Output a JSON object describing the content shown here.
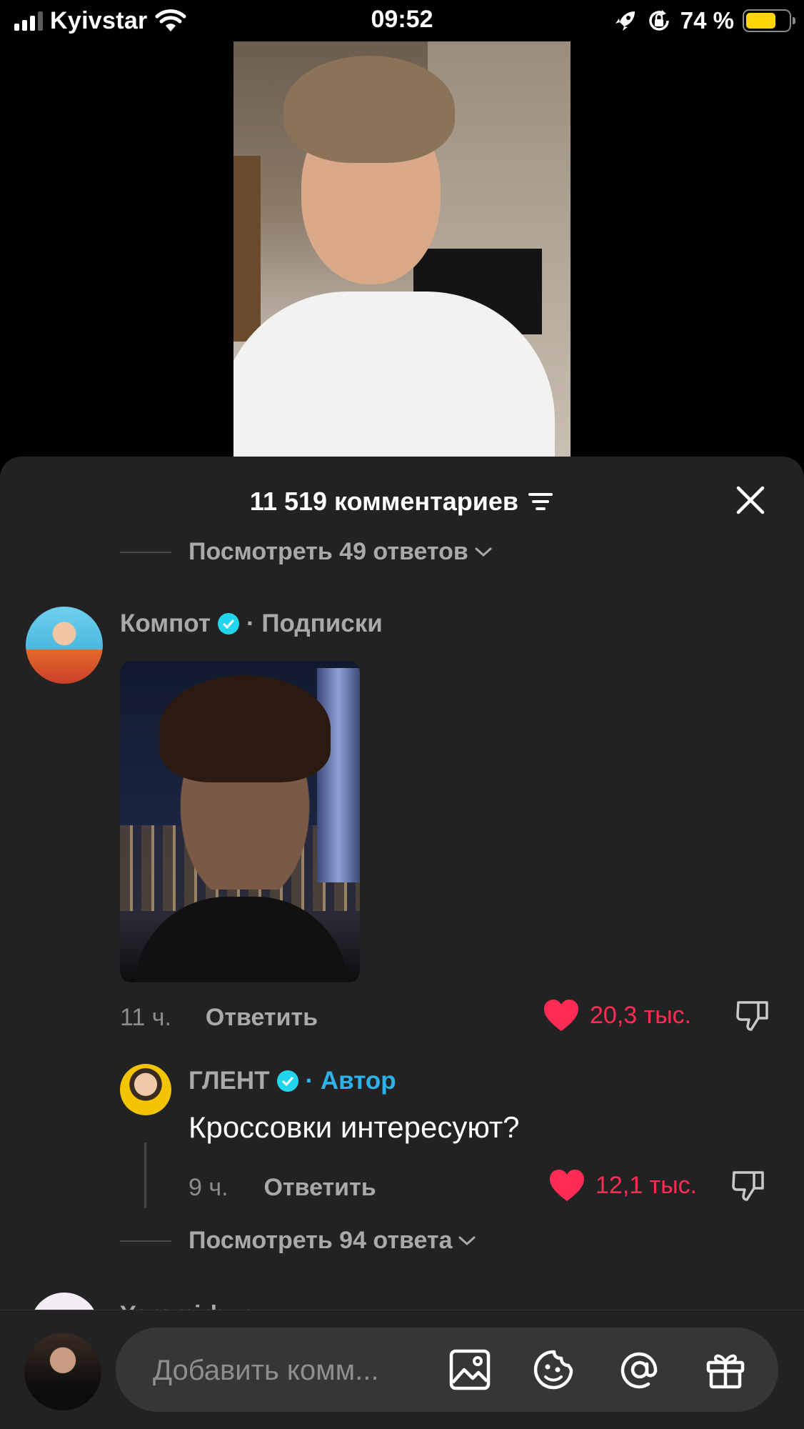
{
  "status_bar": {
    "carrier": "Kyivstar",
    "time": "09:52",
    "battery_percent": "74 %",
    "battery_level": 0.74,
    "battery_color": "#ffd60a"
  },
  "icons": [
    "signal-icon",
    "wifi-icon",
    "rocket-icon",
    "rotation-lock-icon",
    "battery-icon",
    "sort-icon",
    "close-icon",
    "chevron-down-icon",
    "verified-icon",
    "heart-icon",
    "dislike-icon",
    "image-icon",
    "emoji-icon",
    "mention-icon",
    "gift-icon"
  ],
  "sheet": {
    "comment_count": "11 519 комментариев"
  },
  "replies_top": {
    "label": "Посмотреть 49 ответов"
  },
  "comment": {
    "username": "Компот",
    "relation": "· Подписки",
    "time": "11 ч.",
    "reply_label": "Ответить",
    "likes": "20,3 тыс."
  },
  "reply": {
    "username": "ГЛЕНТ",
    "relation": "· Автор",
    "text": "Кроссовки интересуют?",
    "time": "9 ч.",
    "reply_label": "Ответить",
    "likes": "12,1 тыс."
  },
  "replies_bottom": {
    "label": "Посмотреть 94 ответа"
  },
  "next_comment": {
    "username": "Yaromirbun"
  },
  "input": {
    "placeholder": "Добавить комм..."
  },
  "colors": {
    "like": "#fe2c55",
    "verified": "#20d5ec",
    "author_tag": "#2eb0e8",
    "sheet_bg": "#222223"
  }
}
